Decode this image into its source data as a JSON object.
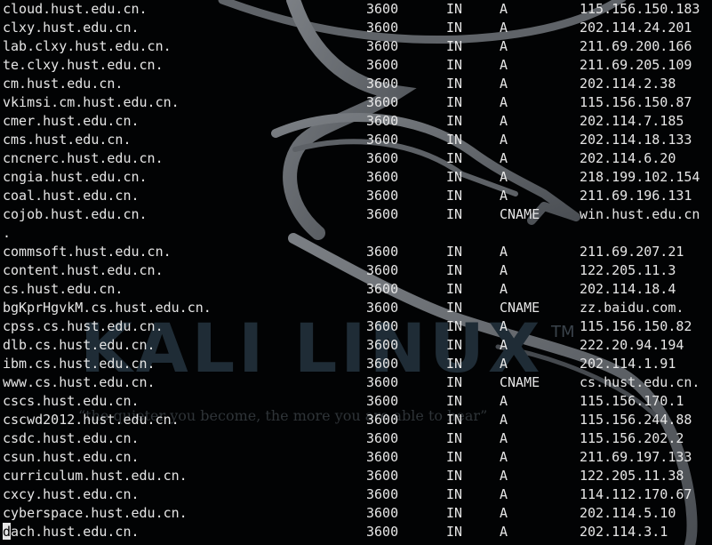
{
  "wallpaper": {
    "logo_text": "KALI LINUX",
    "trademark": "TM",
    "quote": "“the quieter you become, the more you are able to hear”"
  },
  "records": [
    {
      "name": "cloud.hust.edu.cn.",
      "ttl": "3600",
      "class": "IN",
      "type": "A",
      "data": "115.156.150.183"
    },
    {
      "name": "clxy.hust.edu.cn.",
      "ttl": "3600",
      "class": "IN",
      "type": "A",
      "data": "202.114.24.201"
    },
    {
      "name": "lab.clxy.hust.edu.cn.",
      "ttl": "3600",
      "class": "IN",
      "type": "A",
      "data": "211.69.200.166"
    },
    {
      "name": "te.clxy.hust.edu.cn.",
      "ttl": "3600",
      "class": "IN",
      "type": "A",
      "data": "211.69.205.109"
    },
    {
      "name": "cm.hust.edu.cn.",
      "ttl": "3600",
      "class": "IN",
      "type": "A",
      "data": "202.114.2.38"
    },
    {
      "name": "vkimsi.cm.hust.edu.cn.",
      "ttl": "3600",
      "class": "IN",
      "type": "A",
      "data": "115.156.150.87"
    },
    {
      "name": "cmer.hust.edu.cn.",
      "ttl": "3600",
      "class": "IN",
      "type": "A",
      "data": "202.114.7.185"
    },
    {
      "name": "cms.hust.edu.cn.",
      "ttl": "3600",
      "class": "IN",
      "type": "A",
      "data": "202.114.18.133"
    },
    {
      "name": "cncnerc.hust.edu.cn.",
      "ttl": "3600",
      "class": "IN",
      "type": "A",
      "data": "202.114.6.20"
    },
    {
      "name": "cngia.hust.edu.cn.",
      "ttl": "3600",
      "class": "IN",
      "type": "A",
      "data": "218.199.102.154"
    },
    {
      "name": "coal.hust.edu.cn.",
      "ttl": "3600",
      "class": "IN",
      "type": "A",
      "data": "211.69.196.131"
    },
    {
      "name": "cojob.hust.edu.cn.",
      "ttl": "3600",
      "class": "IN",
      "type": "CNAME",
      "data": "win.hust.edu.cn"
    },
    {
      "name": ".",
      "ttl": "",
      "class": "",
      "type": "",
      "data": ""
    },
    {
      "name": "commsoft.hust.edu.cn.",
      "ttl": "3600",
      "class": "IN",
      "type": "A",
      "data": "211.69.207.21"
    },
    {
      "name": "content.hust.edu.cn.",
      "ttl": "3600",
      "class": "IN",
      "type": "A",
      "data": "122.205.11.3"
    },
    {
      "name": "cs.hust.edu.cn.",
      "ttl": "3600",
      "class": "IN",
      "type": "A",
      "data": "202.114.18.4"
    },
    {
      "name": "bgKprHgvkM.cs.hust.edu.cn.",
      "ttl": "3600",
      "class": "IN",
      "type": "CNAME",
      "data": "zz.baidu.com."
    },
    {
      "name": "cpss.cs.hust.edu.cn.",
      "ttl": "3600",
      "class": "IN",
      "type": "A",
      "data": "115.156.150.82"
    },
    {
      "name": "dlb.cs.hust.edu.cn.",
      "ttl": "3600",
      "class": "IN",
      "type": "A",
      "data": "222.20.94.194"
    },
    {
      "name": "ibm.cs.hust.edu.cn.",
      "ttl": "3600",
      "class": "IN",
      "type": "A",
      "data": "202.114.1.91"
    },
    {
      "name": "www.cs.hust.edu.cn.",
      "ttl": "3600",
      "class": "IN",
      "type": "CNAME",
      "data": "cs.hust.edu.cn."
    },
    {
      "name": "cscs.hust.edu.cn.",
      "ttl": "3600",
      "class": "IN",
      "type": "A",
      "data": "115.156.170.1"
    },
    {
      "name": "cscwd2012.hust.edu.cn.",
      "ttl": "3600",
      "class": "IN",
      "type": "A",
      "data": "115.156.244.88"
    },
    {
      "name": "csdc.hust.edu.cn.",
      "ttl": "3600",
      "class": "IN",
      "type": "A",
      "data": "115.156.202.2"
    },
    {
      "name": "csun.hust.edu.cn.",
      "ttl": "3600",
      "class": "IN",
      "type": "A",
      "data": "211.69.197.133"
    },
    {
      "name": "curriculum.hust.edu.cn.",
      "ttl": "3600",
      "class": "IN",
      "type": "A",
      "data": "122.205.11.38"
    },
    {
      "name": "cxcy.hust.edu.cn.",
      "ttl": "3600",
      "class": "IN",
      "type": "A",
      "data": "114.112.170.67"
    },
    {
      "name": "cyberspace.hust.edu.cn.",
      "ttl": "3600",
      "class": "IN",
      "type": "A",
      "data": "202.114.5.10"
    },
    {
      "name": "dach.hust.edu.cn.",
      "ttl": "3600",
      "class": "IN",
      "type": "A",
      "data": "202.114.3.1"
    }
  ],
  "cursor": {
    "char": "d"
  },
  "colors": {
    "background": "#020304",
    "text": "#e6e6e6",
    "dragon": "#6f7378",
    "logo": "#1f2c36"
  }
}
